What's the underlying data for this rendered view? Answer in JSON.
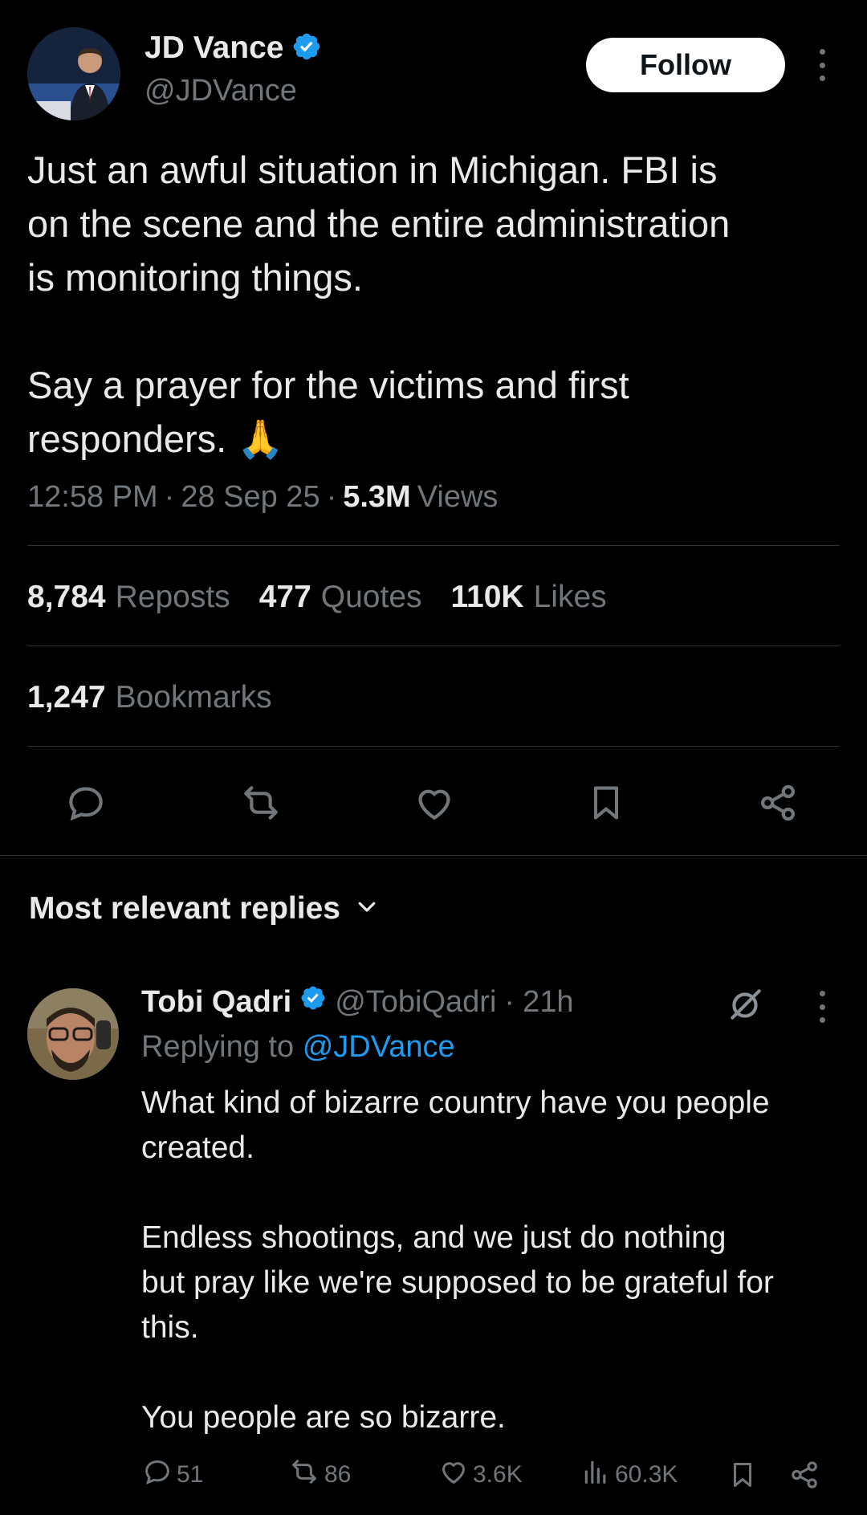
{
  "author": {
    "name": "JD Vance",
    "handle": "@JDVance",
    "verified_color": "#1d9bf0"
  },
  "follow_label": "Follow",
  "tweet": {
    "text": "Just an awful situation in Michigan. FBI is\non the scene and the entire administration\nis monitoring things.\n\nSay a prayer for the victims and first\nresponders. 🙏",
    "time": "12:58 PM",
    "date": "28 Sep 25",
    "views_count": "5.3M",
    "views_label": "Views"
  },
  "stats": {
    "reposts_count": "8,784",
    "reposts_label": "Reposts",
    "quotes_count": "477",
    "quotes_label": "Quotes",
    "likes_count": "110K",
    "likes_label": "Likes",
    "bookmarks_count": "1,247",
    "bookmarks_label": "Bookmarks"
  },
  "actions": [
    "reply-icon",
    "repost-icon",
    "like-icon",
    "bookmark-icon",
    "share-icon"
  ],
  "replies_header": "Most relevant replies",
  "reply": {
    "name": "Tobi Qadri",
    "handle": "@TobiQadri",
    "time": "21h",
    "replying_prefix": "Replying to",
    "replying_to": "@JDVance",
    "text": "What kind of bizarre country have you people\ncreated.\n\nEndless shootings, and we just do nothing\nbut pray like we're supposed to be grateful for\nthis.\n\nYou people are so bizarre.",
    "replies": "51",
    "reposts": "86",
    "likes": "3.6K",
    "views": "60.3K"
  },
  "colors": {
    "background": "#000000",
    "text": "#e7e9ea",
    "muted": "#71767b",
    "link": "#1d9bf0",
    "divider": "#2f3336"
  }
}
